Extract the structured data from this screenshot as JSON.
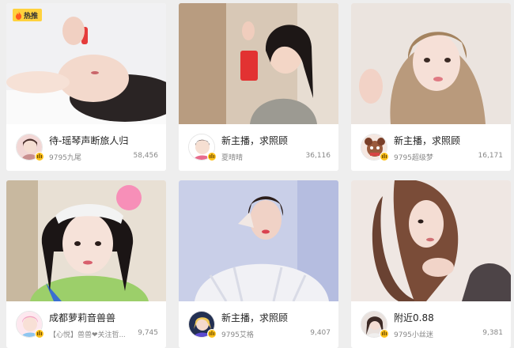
{
  "hot_badge": {
    "label": "热推",
    "icon": "flame-icon",
    "color": "#ffd23e"
  },
  "cards": [
    {
      "title": "待-瑶琴声断旅人归",
      "subtitle": "9795九尾",
      "viewers": "58,456"
    },
    {
      "title": "新主播，求照顾",
      "subtitle": "夏晴晴",
      "viewers": "36,116"
    },
    {
      "title": "新主播，求照顾",
      "subtitle": "9795超级梦",
      "viewers": "16,171"
    },
    {
      "title": "成都萝莉音兽兽",
      "subtitle": "【心悦】兽兽❤关注哲...",
      "viewers": "9,745"
    },
    {
      "title": "新主播，求照顾",
      "subtitle": "9795艾格",
      "viewers": "9,407"
    },
    {
      "title": "附近0.88",
      "subtitle": "9795小丝迷",
      "viewers": "9,381"
    }
  ],
  "level_badge_color": "#ffc21c"
}
